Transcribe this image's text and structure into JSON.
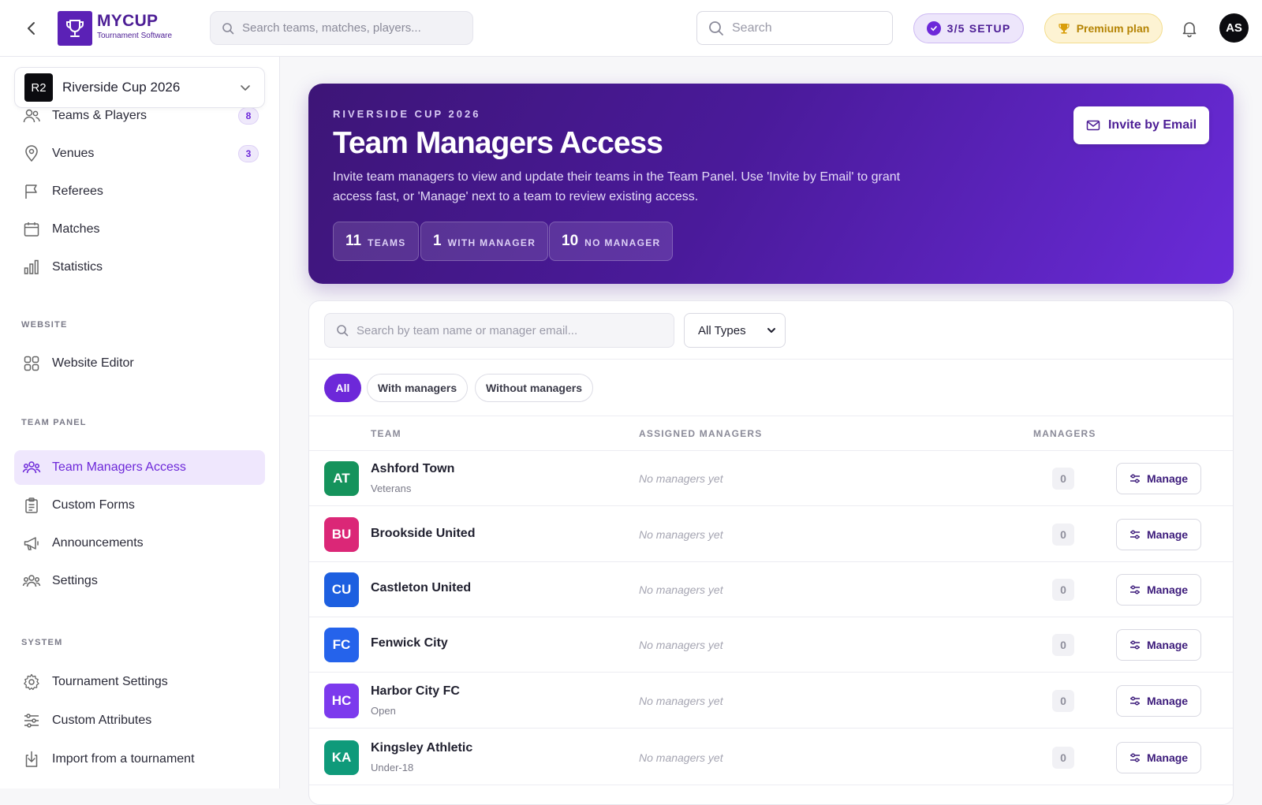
{
  "topbar": {
    "logo_title": "MYCUP",
    "logo_subtitle": "Tournament Software",
    "global_search_placeholder": "Search teams, matches, players...",
    "search_placeholder": "Search",
    "setup_label": "3/5 SETUP",
    "premium_label": "Premium plan",
    "avatar_initials": "AS"
  },
  "sidebar": {
    "tournament_badge": "R2",
    "tournament_name": "Riverside Cup 2026",
    "main_items": [
      {
        "label": "Teams & Players",
        "count": "8"
      },
      {
        "label": "Venues",
        "count": "3"
      },
      {
        "label": "Referees"
      },
      {
        "label": "Matches"
      },
      {
        "label": "Statistics"
      }
    ],
    "website_section": "WEBSITE",
    "website_items": [
      {
        "label": "Website Editor"
      }
    ],
    "team_panel_section": "TEAM PANEL",
    "team_panel_items": [
      {
        "label": "Team Managers Access",
        "active": true
      },
      {
        "label": "Custom Forms"
      },
      {
        "label": "Announcements"
      },
      {
        "label": "Settings"
      }
    ],
    "system_section": "SYSTEM",
    "system_items": [
      {
        "label": "Tournament Settings"
      },
      {
        "label": "Custom Attributes"
      },
      {
        "label": "Import from a tournament"
      }
    ]
  },
  "hero": {
    "eyebrow": "RIVERSIDE CUP 2026",
    "title": "Team Managers Access",
    "description": "Invite team managers to view and update their teams in the Team Panel. Use 'Invite by Email' to grant access fast, or 'Manage' next to a team to review existing access.",
    "stats": [
      {
        "num": "11",
        "label": "TEAMS"
      },
      {
        "num": "1",
        "label": "WITH MANAGER"
      },
      {
        "num": "10",
        "label": "NO MANAGER"
      }
    ],
    "invite_label": "Invite by Email"
  },
  "filters": {
    "search_placeholder": "Search by team name or manager email...",
    "type_selected": "All Types",
    "tabs": [
      "All",
      "With managers",
      "Without managers"
    ]
  },
  "table": {
    "headers": {
      "team": "TEAM",
      "assigned": "ASSIGNED MANAGERS",
      "managers": "MANAGERS"
    },
    "manage_label": "Manage",
    "rows": [
      {
        "initials": "AT",
        "color": "#15935c",
        "name": "Ashford Town",
        "category": "Veterans",
        "assigned": "No managers yet",
        "count": "0"
      },
      {
        "initials": "BU",
        "color": "#db2777",
        "name": "Brookside United",
        "category": "",
        "assigned": "No managers yet",
        "count": "0"
      },
      {
        "initials": "CU",
        "color": "#1d5fe0",
        "name": "Castleton United",
        "category": "",
        "assigned": "No managers yet",
        "count": "0"
      },
      {
        "initials": "FC",
        "color": "#2563eb",
        "name": "Fenwick City",
        "category": "",
        "assigned": "No managers yet",
        "count": "0"
      },
      {
        "initials": "HC",
        "color": "#7c3aed",
        "name": "Harbor City FC",
        "category": "Open",
        "assigned": "No managers yet",
        "count": "0"
      },
      {
        "initials": "KA",
        "color": "#0f9a7a",
        "name": "Kingsley Athletic",
        "category": "Under-18",
        "assigned": "No managers yet",
        "count": "0"
      }
    ]
  }
}
